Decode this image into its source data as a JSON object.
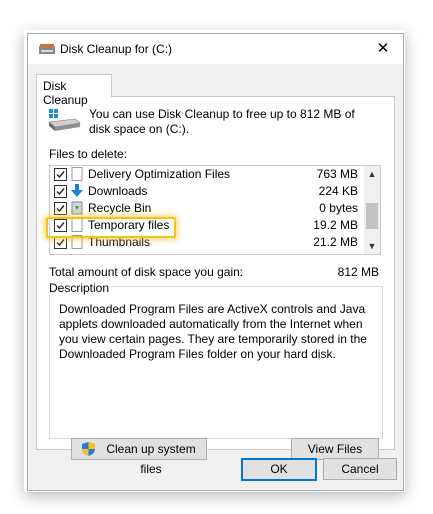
{
  "window": {
    "title": "Disk Cleanup for  (C:)"
  },
  "tabs": [
    {
      "label": "Disk Cleanup"
    }
  ],
  "intro_text": "You can use Disk Cleanup to free up to 812 MB of disk space on  (C:).",
  "files_label": "Files to delete:",
  "files": [
    {
      "name": "Delivery Optimization Files",
      "size": "763 MB",
      "checked": true,
      "icon": "blank-file-icon"
    },
    {
      "name": "Downloads",
      "size": "224 KB",
      "checked": true,
      "icon": "download-arrow-icon"
    },
    {
      "name": "Recycle Bin",
      "size": "0 bytes",
      "checked": true,
      "icon": "recycle-bin-icon"
    },
    {
      "name": "Temporary files",
      "size": "19.2 MB",
      "checked": true,
      "icon": "blank-file-icon"
    },
    {
      "name": "Thumbnails",
      "size": "21.2 MB",
      "checked": true,
      "icon": "blank-file-icon"
    }
  ],
  "total_label": "Total amount of disk space you gain:",
  "total_value": "812 MB",
  "description": {
    "title": "Description",
    "text": "Downloaded Program Files are ActiveX controls and Java applets downloaded automatically from the Internet when you view certain pages. They are temporarily stored in the Downloaded Program Files folder on your hard disk."
  },
  "buttons": {
    "cleanup_system": "Clean up system files",
    "view_files": "View Files",
    "ok": "OK",
    "cancel": "Cancel"
  },
  "colors": {
    "highlight": "#f5c11d",
    "ok_border": "#0078d7"
  }
}
